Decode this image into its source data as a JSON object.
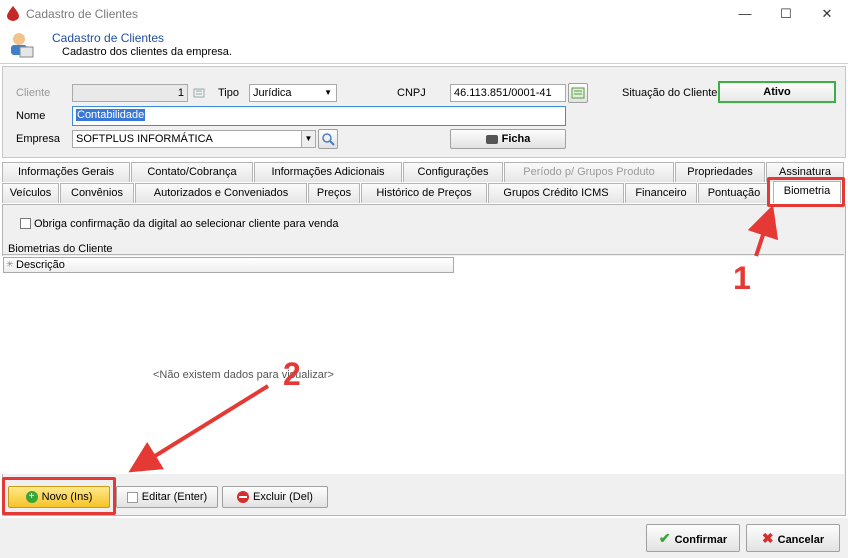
{
  "window": {
    "title": "Cadastro de Clientes",
    "minimize": "—",
    "maximize": "☐",
    "close": "✕"
  },
  "header": {
    "title": "Cadastro de Clientes",
    "subtitle": "Cadastro dos clientes da empresa."
  },
  "form": {
    "cliente_label": "Cliente",
    "cliente_value": "1",
    "tipo_label": "Tipo",
    "tipo_value": "Jurídica",
    "cnpj_label": "CNPJ",
    "cnpj_value": "46.113.851/0001-41",
    "situacao_label": "Situação do Cliente",
    "situacao_value": "Ativo",
    "nome_label": "Nome",
    "nome_value": "Contabilidade",
    "empresa_label": "Empresa",
    "empresa_value": "SOFTPLUS INFORMÁTICA",
    "ficha_label": "Ficha"
  },
  "tabs_row1": [
    "Informações Gerais",
    "Contato/Cobrança",
    "Informações Adicionais",
    "Configurações",
    "Período p/ Grupos Produto",
    "Propriedades",
    "Assinatura"
  ],
  "tabs_row2": [
    "Veículos",
    "Convênios",
    "Autorizados e Conveniados",
    "Preços",
    "Histórico de Preços",
    "Grupos Crédito ICMS",
    "Financeiro",
    "Pontuação",
    "Biometria"
  ],
  "biometria": {
    "checkbox_label": "Obriga confirmação da digital ao selecionar cliente para venda",
    "group_label": "Biometrias do Cliente",
    "column_header": "Descrição",
    "empty_text": "<Não existem dados para visualizar>",
    "novo_label": "Novo (Ins)",
    "editar_label": "Editar (Enter)",
    "excluir_label": "Excluir (Del)"
  },
  "footer": {
    "confirmar_label": "Confirmar",
    "cancelar_label": "Cancelar"
  },
  "annotations": {
    "one": "1",
    "two": "2"
  },
  "colors": {
    "annotation": "#e53935",
    "status_border": "#3cb043",
    "header_title": "#1f4fa0"
  }
}
